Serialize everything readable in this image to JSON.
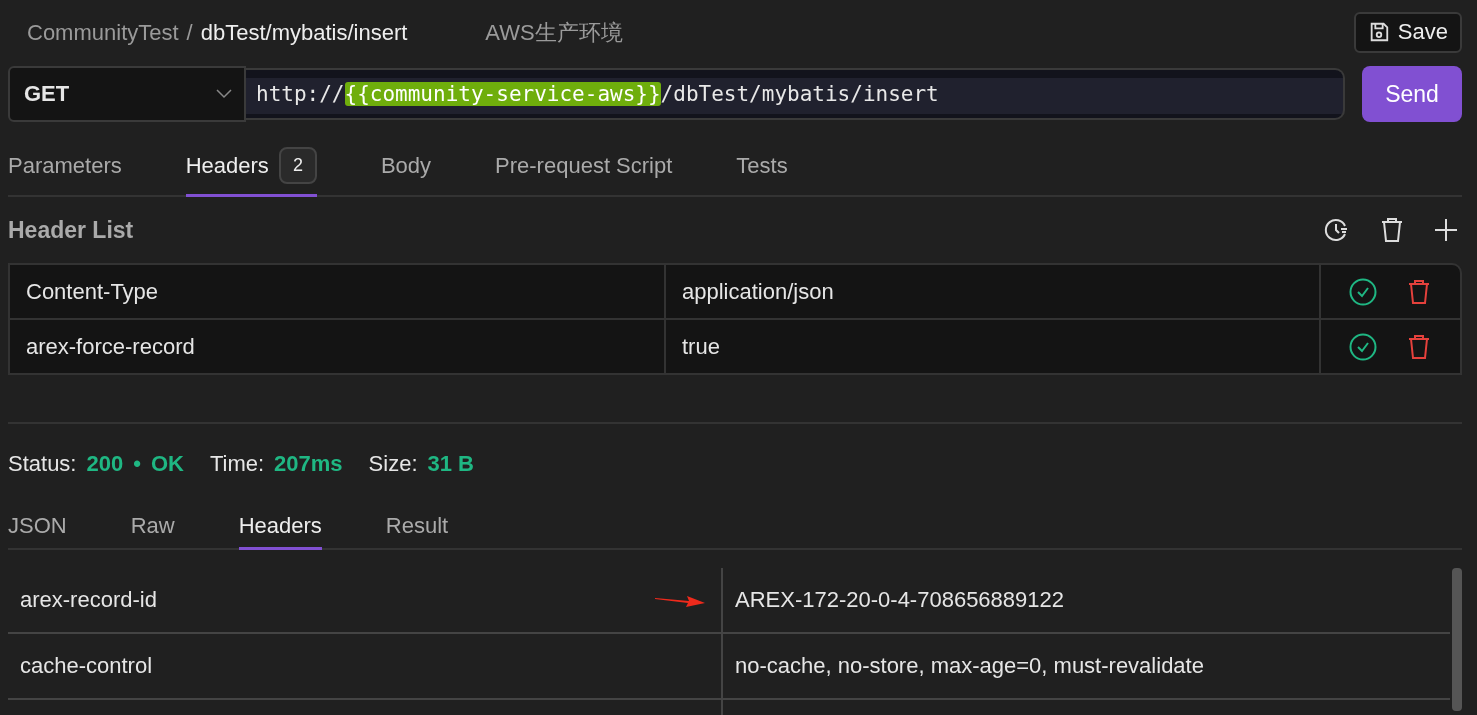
{
  "breadcrumb": {
    "parent": "CommunityTest",
    "separator": "/",
    "current": "dbTest/mybatis/insert"
  },
  "environment": "AWS生产环境",
  "save_button": "Save",
  "method": "GET",
  "url": {
    "prefix": "http://",
    "variable": "{{community-service-aws}}",
    "suffix": "/dbTest/mybatis/insert"
  },
  "send_button": "Send",
  "request_tabs": [
    {
      "label": "Parameters",
      "selected": false
    },
    {
      "label": "Headers",
      "selected": true,
      "badge": "2"
    },
    {
      "label": "Body",
      "selected": false
    },
    {
      "label": "Pre-request Script",
      "selected": false
    },
    {
      "label": "Tests",
      "selected": false
    }
  ],
  "header_list": {
    "title": "Header List",
    "rows": [
      {
        "key": "Content-Type",
        "value": "application/json",
        "enabled": true
      },
      {
        "key": "arex-force-record",
        "value": "true",
        "enabled": true
      }
    ]
  },
  "status": [
    {
      "label": "Status:",
      "values": [
        "200",
        "•",
        "OK"
      ]
    },
    {
      "label": "Time:",
      "values": [
        "207ms"
      ]
    },
    {
      "label": "Size:",
      "values": [
        "31 B"
      ]
    }
  ],
  "response_tabs": [
    {
      "label": "JSON",
      "selected": false
    },
    {
      "label": "Raw",
      "selected": false
    },
    {
      "label": "Headers",
      "selected": true
    },
    {
      "label": "Result",
      "selected": false
    }
  ],
  "response_headers": [
    {
      "name": "arex-record-id",
      "value": "AREX-172-20-0-4-708656889122",
      "annotated": true
    },
    {
      "name": "cache-control",
      "value": "no-cache, no-store, max-age=0, must-revalidate",
      "annotated": false
    }
  ]
}
